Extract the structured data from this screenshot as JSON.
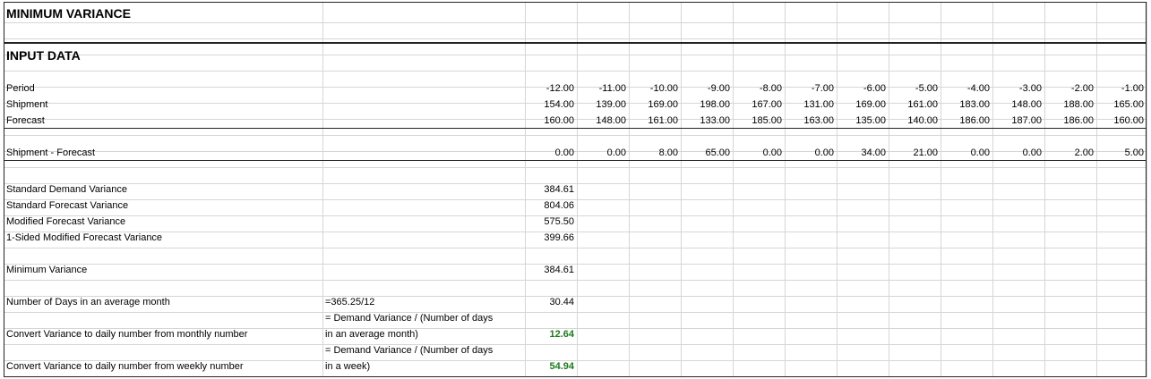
{
  "title": "MINIMUM VARIANCE",
  "input_header": "INPUT DATA",
  "period": {
    "label": "Period",
    "values": [
      "-12.00",
      "-11.00",
      "-10.00",
      "-9.00",
      "-8.00",
      "-7.00",
      "-6.00",
      "-5.00",
      "-4.00",
      "-3.00",
      "-2.00",
      "-1.00"
    ]
  },
  "shipment": {
    "label": "Shipment",
    "values": [
      "154.00",
      "139.00",
      "169.00",
      "198.00",
      "167.00",
      "131.00",
      "169.00",
      "161.00",
      "183.00",
      "148.00",
      "188.00",
      "165.00"
    ]
  },
  "forecast": {
    "label": "Forecast",
    "values": [
      "160.00",
      "148.00",
      "161.00",
      "133.00",
      "185.00",
      "163.00",
      "135.00",
      "140.00",
      "186.00",
      "187.00",
      "186.00",
      "160.00"
    ]
  },
  "diff": {
    "label": "Shipment - Forecast",
    "values": [
      "0.00",
      "0.00",
      "8.00",
      "65.00",
      "0.00",
      "0.00",
      "34.00",
      "21.00",
      "0.00",
      "0.00",
      "2.00",
      "5.00"
    ]
  },
  "variances": [
    {
      "label": "Standard Demand Variance",
      "value": "384.61"
    },
    {
      "label": "Standard Forecast Variance",
      "value": "804.06"
    },
    {
      "label": "Modified Forecast Variance",
      "value": "575.50"
    },
    {
      "label": "1-Sided Modified Forecast Variance",
      "value": "399.66"
    }
  ],
  "minimum": {
    "label": "Minimum Variance",
    "value": "384.61"
  },
  "days": {
    "label": "Number of Days in an average month",
    "formula": "=365.25/12",
    "value": "30.44"
  },
  "daily_monthly": {
    "label": "Convert Variance to daily number from monthly number",
    "formula_line1": "= Demand Variance / (Number of days",
    "formula_line2": "in an average month)",
    "value": "12.64"
  },
  "daily_weekly": {
    "label": "Convert Variance to daily number from weekly number",
    "formula_line1": "= Demand Variance / (Number of days",
    "formula_line2": "in a week)",
    "value": "54.94"
  },
  "colors": {
    "grid": "#d6d6d6",
    "border": "#222222",
    "result_green": "#1e7a1e"
  }
}
